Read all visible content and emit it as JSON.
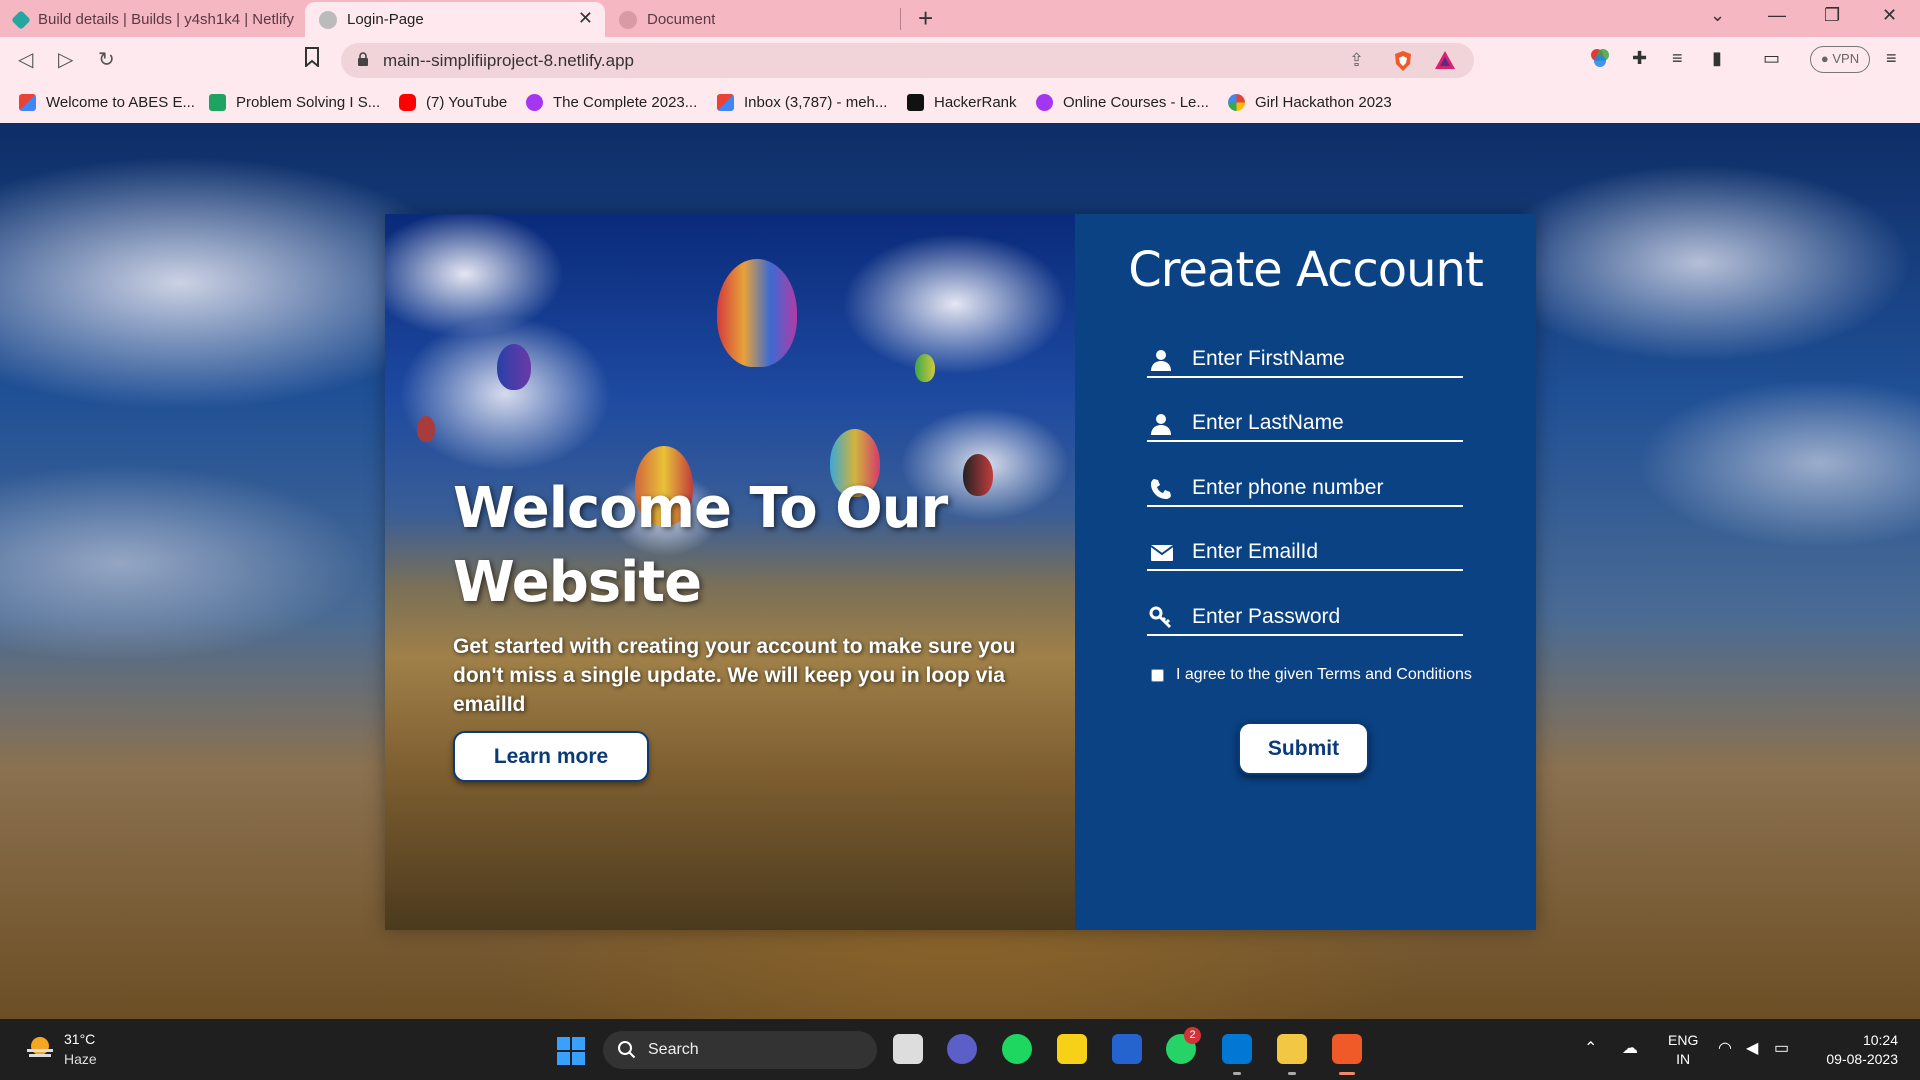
{
  "browser": {
    "tabs": [
      {
        "label": "Build details | Builds | y4sh1k4 | Netlify",
        "active": false
      },
      {
        "label": "Login-Page",
        "active": true
      },
      {
        "label": "Document",
        "active": false
      }
    ],
    "url": "main--simplifiiproject-8.netlify.app",
    "vpn_label": "VPN",
    "bookmarks": [
      {
        "label": "Welcome to ABES E...",
        "icon": "gmail-icon"
      },
      {
        "label": "Problem Solving I S...",
        "icon": "plus-icon"
      },
      {
        "label": "(7) YouTube",
        "icon": "youtube-icon"
      },
      {
        "label": "The Complete 2023...",
        "icon": "udemy-icon"
      },
      {
        "label": "Inbox (3,787) - meh...",
        "icon": "gmail-icon"
      },
      {
        "label": "HackerRank",
        "icon": "hackerrank-icon"
      },
      {
        "label": "Online Courses - Le...",
        "icon": "udemy-icon"
      },
      {
        "label": "Girl Hackathon 2023",
        "icon": "google-icon"
      }
    ]
  },
  "hero": {
    "title": "Welcome To Our Website",
    "text": "Get started with creating your account to make sure you don't miss a single update. We will keep you in loop via emailId",
    "button_label": "Learn more"
  },
  "form": {
    "title": "Create Account",
    "fields": [
      {
        "placeholder": "Enter FirstName",
        "icon": "user-icon"
      },
      {
        "placeholder": "Enter LastName",
        "icon": "user-icon"
      },
      {
        "placeholder": "Enter phone number",
        "icon": "phone-icon"
      },
      {
        "placeholder": "Enter EmailId",
        "icon": "envelope-icon"
      },
      {
        "placeholder": "Enter Password",
        "icon": "key-icon"
      }
    ],
    "terms_label": "I agree to the given Terms and Conditions",
    "submit_label": "Submit"
  },
  "taskbar": {
    "temperature": "31°C",
    "condition": "Haze",
    "search_label": "Search",
    "whatsapp_badge": "2",
    "lang_line1": "ENG",
    "lang_line2": "IN",
    "time": "10:24",
    "date": "09-08-2023"
  },
  "colors": {
    "form_panel": "#0a4283",
    "button_text": "#0a3b78",
    "tab_bar": "#f5b7c2"
  }
}
